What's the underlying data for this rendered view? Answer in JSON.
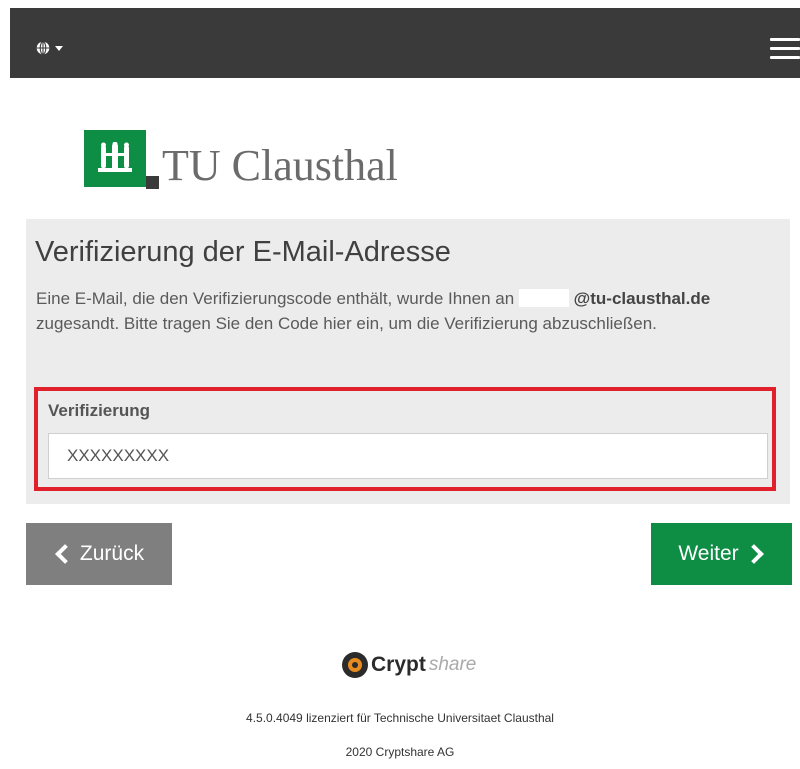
{
  "header": {
    "language_icon": "globe-icon",
    "menu_icon": "hamburger-menu-icon"
  },
  "logo": {
    "text": "TU Clausthal",
    "brand_color": "#0e8d45"
  },
  "verification": {
    "title": "Verifizierung der E-Mail-Adresse",
    "desc_start": "Eine E-Mail, die den Verifizierungscode enthält, wurde Ihnen an",
    "email_domain": "@tu-clausthal.de",
    "desc_end": "zugesandt. Bitte tragen Sie den Code hier ein, um die Verifizierung abzuschließen.",
    "field_label": "Verifizierung",
    "field_value": "XXXXXXXXX",
    "highlight_color": "#e0202a"
  },
  "buttons": {
    "back": "Zurück",
    "next": "Weiter"
  },
  "footer": {
    "brand_strong": "Crypt",
    "brand_light": "share",
    "license": "4.5.0.4049 lizenziert für Technische Universitaet Clausthal",
    "copyright": "2020 Cryptshare AG"
  }
}
